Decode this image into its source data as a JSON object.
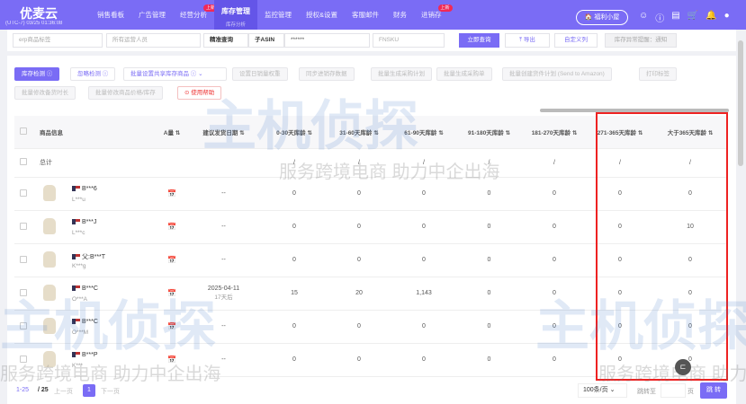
{
  "app": {
    "logo": "优麦云",
    "timezone": "(UTC-7) 03/25 01:36:08"
  },
  "nav": [
    {
      "label": "销售看板"
    },
    {
      "label": "广告管理"
    },
    {
      "label": "经营分析",
      "badge": "上新"
    },
    {
      "label": "库存管理",
      "sub": "库存分析",
      "active": true
    },
    {
      "label": "监控管理"
    },
    {
      "label": "授权&设置"
    },
    {
      "label": "客服邮件"
    },
    {
      "label": "财务"
    },
    {
      "label": "进销存",
      "badge": "上新"
    }
  ],
  "header": {
    "welfare": "福利小屋"
  },
  "filters": {
    "erp_tag": "erp商品标签",
    "operator": "所有运营人员",
    "match": "精准查询",
    "asin_type": "子ASIN",
    "search_value": "******",
    "fnsku": "FNSKU",
    "query": "立即查询",
    "export": "导出",
    "custom_cols": "自定义列",
    "alert": "库存异常提醒：通知"
  },
  "actions": {
    "inventory_check": "库存检测",
    "ignore_check": "忽略检测",
    "bulk_shared": "批量设置共享库存商品",
    "daily_weight": "设置日销量权重",
    "sync": "同步进销存数据",
    "bulk_plan": "批量生成采购计划",
    "bulk_po": "批量生成采购单",
    "bulk_ship": "批量创建货件计划 (Send to Amazon)",
    "print": "打印标签",
    "bulk_stock_time": "批量修改备货时长",
    "bulk_price": "批量修改商品价格/库存",
    "help": "使用帮助"
  },
  "table": {
    "headers": [
      "商品信息",
      "A量",
      "建议发货日期",
      "0-30天库龄",
      "31-60天库龄",
      "61-90天库龄",
      "91-180天库龄",
      "181-270天库龄",
      "271-365天库龄",
      "大于365天库龄"
    ],
    "total": {
      "label": "总计",
      "values": [
        "/",
        "/",
        "/",
        "/",
        "/",
        "/",
        "/"
      ]
    },
    "rows": [
      {
        "asin": "B***6",
        "sku": "L***u",
        "date": "--",
        "days": "",
        "values": [
          "0",
          "0",
          "0",
          "0",
          "0",
          "0",
          "0"
        ]
      },
      {
        "asin": "B***J",
        "sku": "L***c",
        "date": "--",
        "days": "",
        "values": [
          "0",
          "0",
          "0",
          "0",
          "0",
          "0",
          "10"
        ]
      },
      {
        "asin": "父:B***T",
        "sku": "K***g",
        "date": "--",
        "days": "",
        "values": [
          "0",
          "0",
          "0",
          "0",
          "0",
          "0",
          "0"
        ]
      },
      {
        "asin": "B***C",
        "sku": "O***A",
        "date": "2025-04-11",
        "days": "17天后",
        "values": [
          "15",
          "20",
          "1,143",
          "0",
          "0",
          "0",
          "0"
        ]
      },
      {
        "asin": "B***C",
        "sku": "O***M",
        "date": "--",
        "days": "",
        "values": [
          "0",
          "0",
          "0",
          "0",
          "0",
          "0",
          "0"
        ]
      },
      {
        "asin": "B***P",
        "sku": "K***",
        "date": "--",
        "days": "",
        "values": [
          "0",
          "0",
          "0",
          "0",
          "0",
          "0",
          "0"
        ]
      }
    ]
  },
  "pagination": {
    "range": "1-25",
    "total": "/ 25",
    "prev": "上一页",
    "page": "1",
    "next": "下一页",
    "page_size": "100条/页",
    "goto": "跳转至",
    "page_unit": "页",
    "jump": "跳 转"
  },
  "watermark": {
    "logo": "主机侦探",
    "slogan": "服务跨境电商 助力中企出海"
  }
}
